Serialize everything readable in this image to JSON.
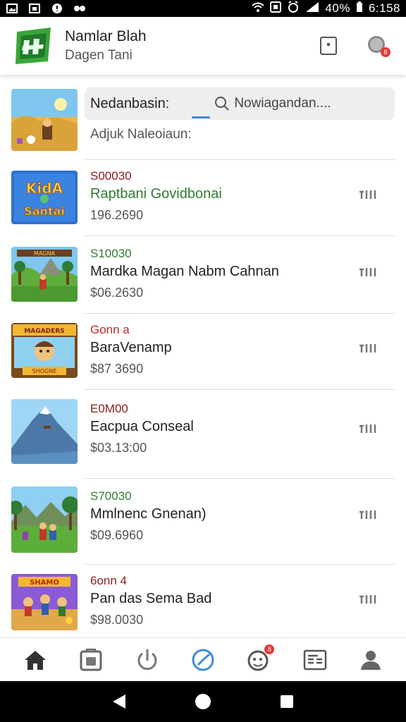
{
  "status_bar": {
    "battery": "40%",
    "time": "6:158"
  },
  "header": {
    "title": "Namlar Blah",
    "subtitle": "Dagen Tani"
  },
  "featured": {
    "search_label": "Nedanbasin:",
    "search_placeholder": "Nowiagandan....",
    "caption": "Adjuk Naleoiaun:"
  },
  "items": [
    {
      "price_top": "S00030",
      "price_top_color": "#8b1a1a",
      "name": "Raptbani Govidbonai",
      "name_color": "#2e7d32",
      "value": "196.2690",
      "thumb_text": "KidA Santai"
    },
    {
      "price_top": "S10030",
      "price_top_color": "#2e7d32",
      "name": "Mardka Magan Nabm Cahnan",
      "name_color": "#222222",
      "value": "$06.2630",
      "thumb_text": "MAGNA"
    },
    {
      "price_top": "Gonn a",
      "price_top_color": "#c62828",
      "name": "BaraVenamp",
      "name_color": "#222222",
      "value": "$87 3690",
      "thumb_text": "MAGADERS"
    },
    {
      "price_top": "E0M00",
      "price_top_color": "#8b1a1a",
      "name": "Eacpua Conseal",
      "name_color": "#222222",
      "value": "$03.13:00",
      "thumb_text": ""
    },
    {
      "price_top": "S70030",
      "price_top_color": "#2e7d32",
      "name": "Mmlnenc Gnenan)",
      "name_color": "#222222",
      "value": "$09.6960",
      "thumb_text": ""
    },
    {
      "price_top": "6onn 4",
      "price_top_color": "#8b1a1a",
      "name": "Pan das Sema Bad",
      "name_color": "#222222",
      "value": "$98.0030",
      "thumb_text": "SHAMO"
    }
  ],
  "nav_badge": "8",
  "header_badge": "8",
  "colors": {
    "accent": "#3d8bdb",
    "badge": "#e53935"
  }
}
